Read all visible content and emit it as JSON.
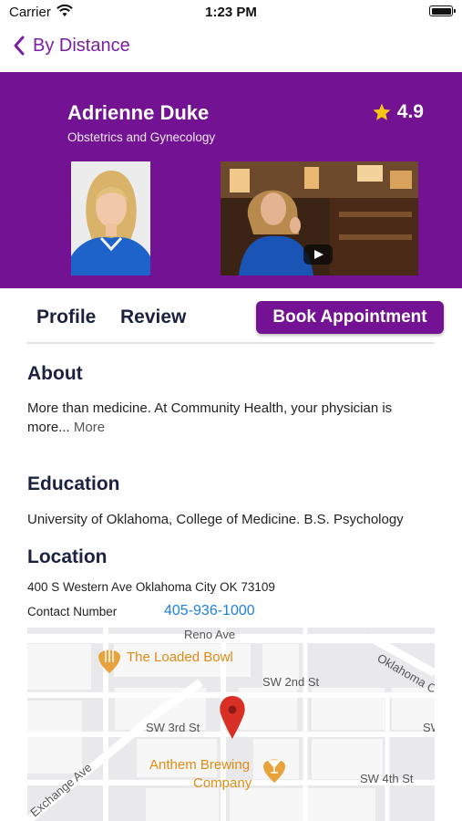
{
  "status_bar": {
    "carrier": "Carrier",
    "time": "1:23 PM"
  },
  "nav": {
    "back_label": "By Distance"
  },
  "doctor": {
    "name": "Adrienne Duke",
    "specialty": "Obstetrics and Gynecology",
    "rating": "4.9"
  },
  "tabs": {
    "profile": "Profile",
    "review": "Review",
    "book": "Book Appointment"
  },
  "about": {
    "heading": "About",
    "text": "More than medicine. At Community Health, your physician is more...",
    "more": "More"
  },
  "education": {
    "heading": "Education",
    "text": "University of Oklahoma, College of Medicine. B.S. Psychology"
  },
  "location": {
    "heading": "Location",
    "address": "400 S Western Ave Oklahoma City OK 73109",
    "contact_label": "Contact Number",
    "contact_number": "405-936-1000"
  },
  "map": {
    "streets": {
      "reno": "Reno Ave",
      "oklahoma": "Oklahoma C",
      "sw2": "SW 2nd St",
      "sw3": "SW 3rd St",
      "sw4": "SW 4th St",
      "exchange": "Exchange Ave",
      "sw_edge": "SW"
    },
    "places": {
      "loaded_bowl": "The Loaded Bowl",
      "anthem_1": "Anthem Brewing",
      "anthem_2": "Company"
    }
  },
  "colors": {
    "brand_purple": "#731394",
    "link_blue": "#1e7fe0",
    "pin_red": "#d93025",
    "poi_orange": "#e8a33d"
  }
}
